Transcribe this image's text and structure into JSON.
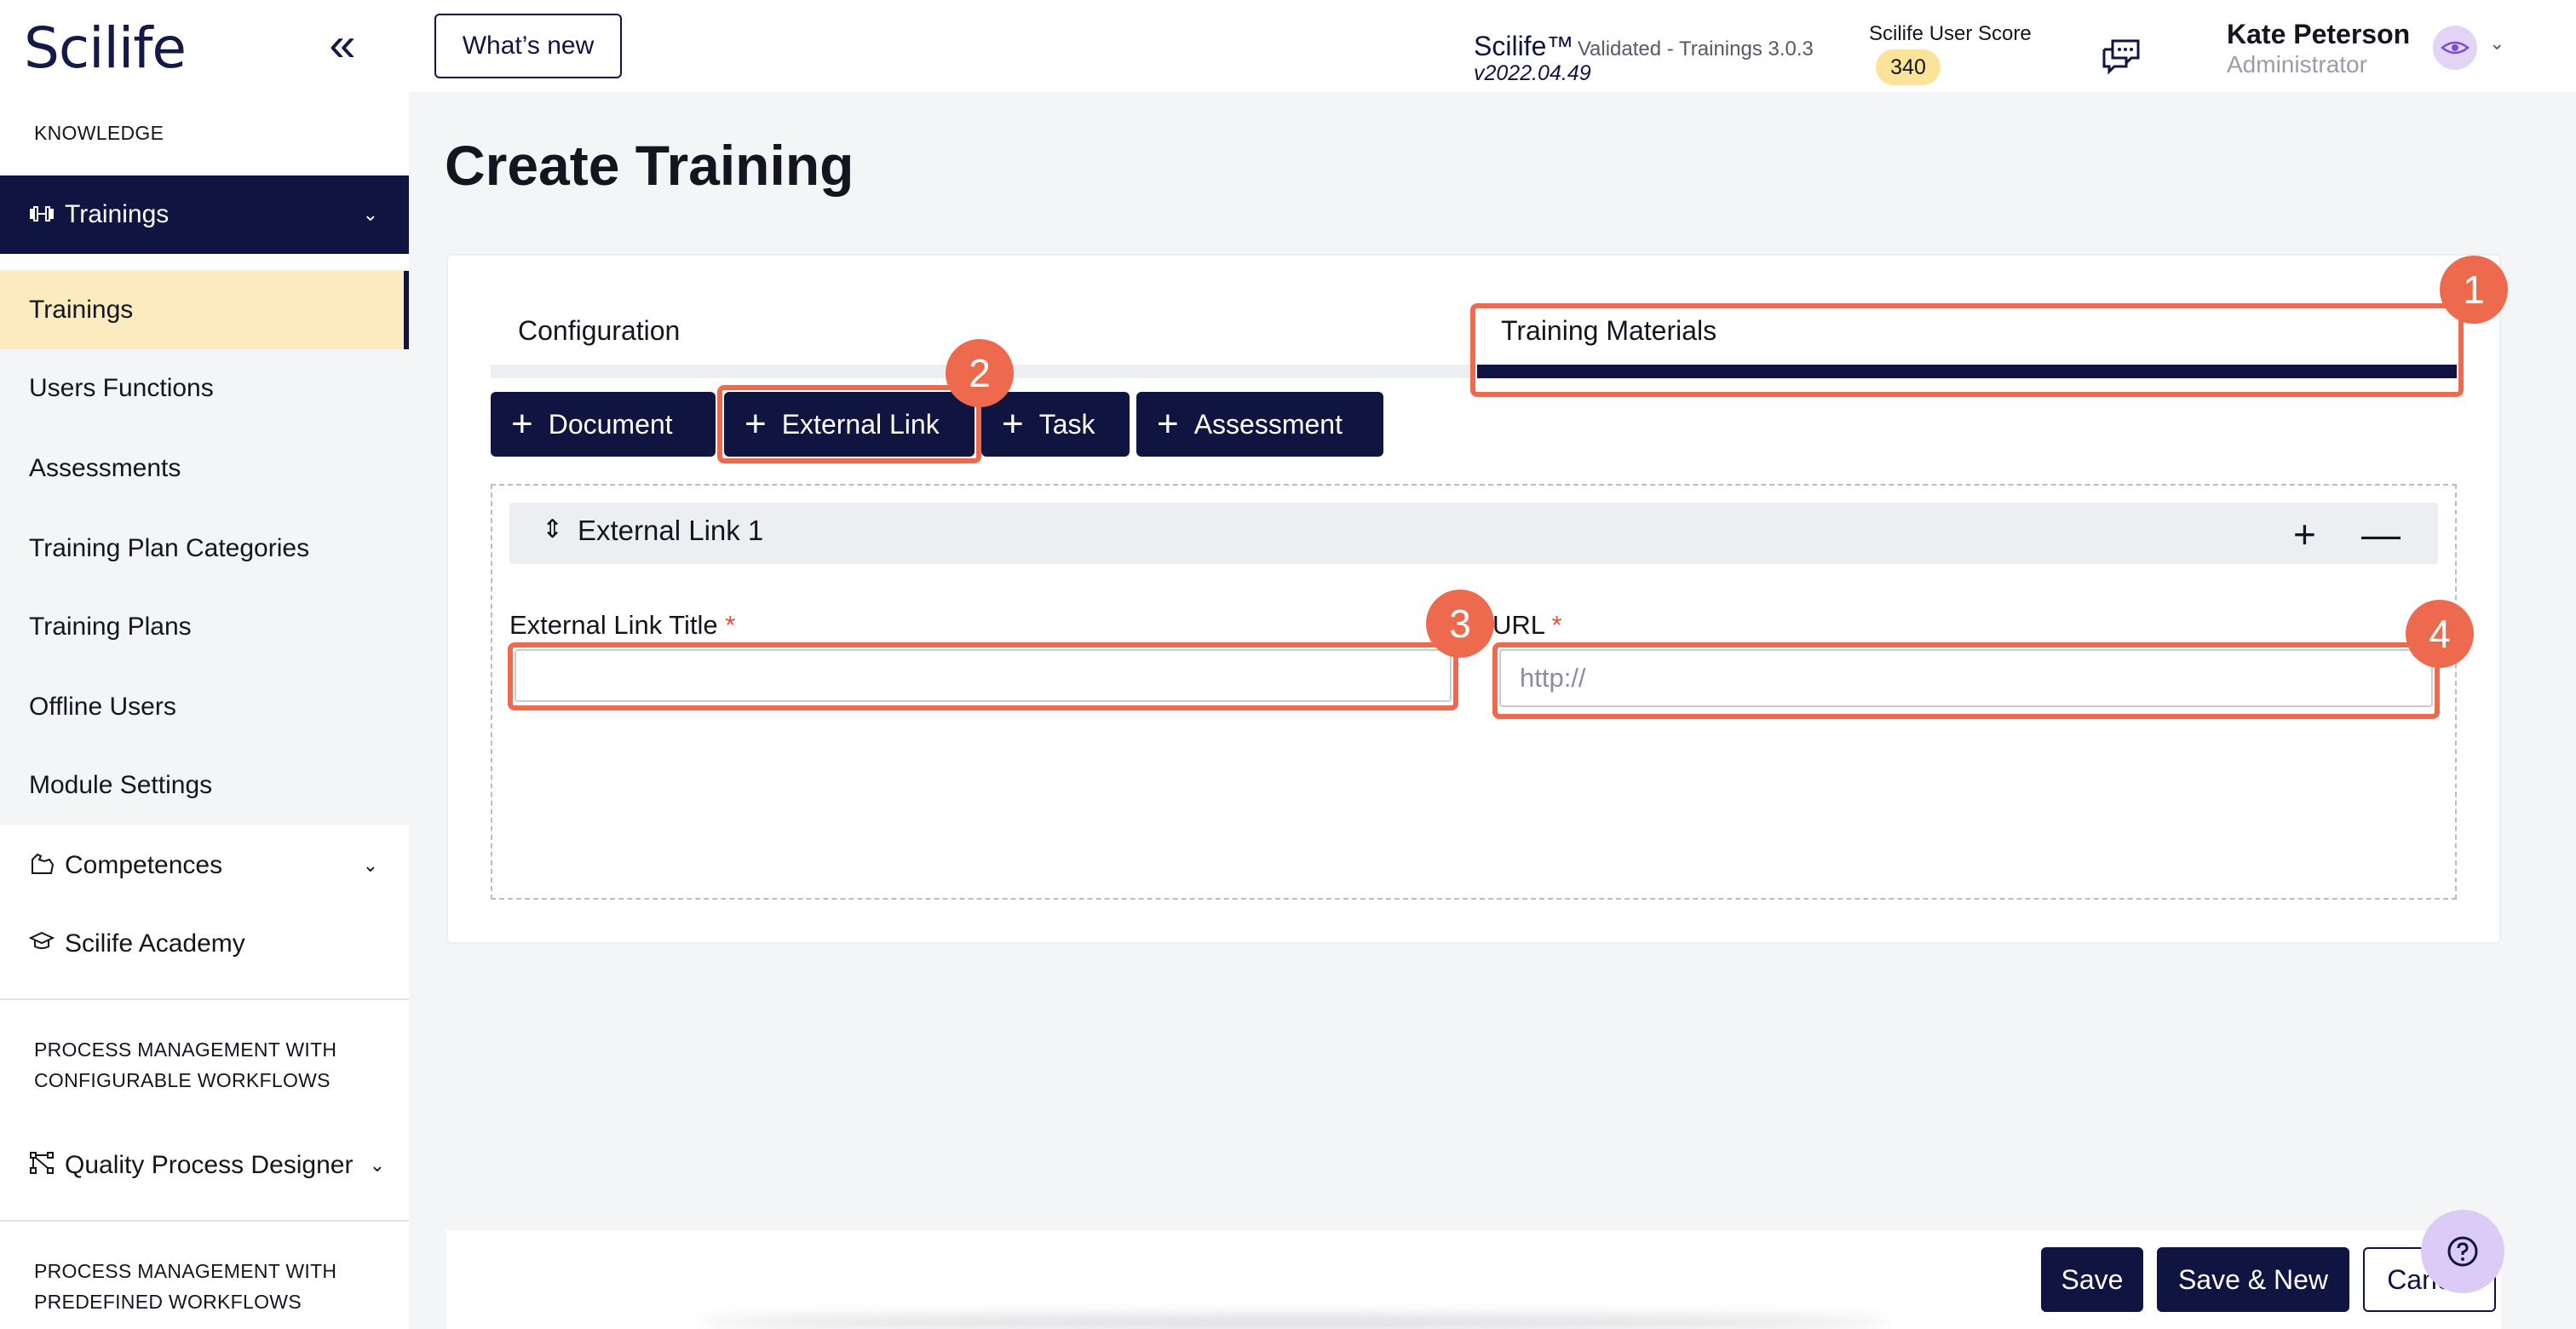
{
  "sidebar": {
    "logo": "Scilife",
    "collapse_icon": "«",
    "section_knowledge": "KNOWLEDGE",
    "trainings_parent": "Trainings",
    "items": [
      {
        "label": "Trainings"
      },
      {
        "label": "Users Functions"
      },
      {
        "label": "Assessments"
      },
      {
        "label": "Training Plan Categories"
      },
      {
        "label": "Training Plans"
      },
      {
        "label": "Offline Users"
      },
      {
        "label": "Module Settings"
      }
    ],
    "competences": "Competences",
    "academy": "Scilife Academy",
    "section_configurable_1": "PROCESS MANAGEMENT WITH",
    "section_configurable_2": "CONFIGURABLE WORKFLOWS",
    "quality_designer": "Quality Process Designer",
    "section_predefined_1": "PROCESS MANAGEMENT WITH",
    "section_predefined_2": "PREDEFINED WORKFLOWS"
  },
  "header": {
    "whats_new": "What’s new",
    "product": "Scilife™",
    "product_sub": "Validated - Trainings 3.0.3",
    "version": "v2022.04.49",
    "score_label": "Scilife User Score",
    "score_value": "340",
    "user_name": "Kate Peterson",
    "user_role": "Administrator"
  },
  "main": {
    "title": "Create Training",
    "tabs": [
      {
        "label": "Configuration"
      },
      {
        "label": "Training Materials"
      }
    ],
    "add_buttons": [
      {
        "label": "Document"
      },
      {
        "label": "External Link"
      },
      {
        "label": "Task"
      },
      {
        "label": "Assessment"
      }
    ],
    "item": {
      "title": "External Link 1",
      "title_field_label": "External Link Title",
      "title_field_value": "",
      "url_field_label": "URL",
      "url_placeholder": "http://",
      "required_mark": "*"
    }
  },
  "footer": {
    "save": "Save",
    "save_new": "Save & New",
    "cancel": "Cancel"
  },
  "annotations": [
    "1",
    "2",
    "3",
    "4"
  ],
  "colors": {
    "brand_navy": "#101440",
    "highlight": "#ee6a4f",
    "selected_item": "#fcebbf",
    "score_badge": "#fbe39a"
  }
}
